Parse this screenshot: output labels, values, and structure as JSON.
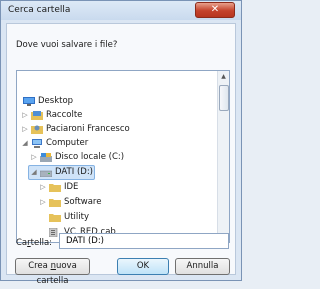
{
  "window": {
    "title": "Cerca cartella",
    "close_glyph": "✕"
  },
  "dialog": {
    "prompt": "Dove vuoi salvare i file?"
  },
  "tree": {
    "items": [
      {
        "label": "Desktop",
        "icon": "desktop-icon"
      },
      {
        "label": "Raccolte",
        "icon": "libraries-icon"
      },
      {
        "label": "Paciaroni Francesco",
        "icon": "user-folder-icon"
      },
      {
        "label": "Computer",
        "icon": "computer-icon"
      },
      {
        "label": "Disco locale (C:)",
        "icon": "local-disk-icon"
      },
      {
        "label": "DATI (D:)",
        "icon": "drive-icon",
        "selected": true
      },
      {
        "label": "IDE",
        "icon": "folder-icon"
      },
      {
        "label": "Software",
        "icon": "folder-icon"
      },
      {
        "label": "Utility",
        "icon": "folder-icon"
      },
      {
        "label": "VC_RED.cab",
        "icon": "cab-file-icon"
      }
    ]
  },
  "folder_field": {
    "label_prefix": "Ca",
    "label_underlined": "r",
    "label_suffix": "tella:",
    "value": "DATI (D:)"
  },
  "buttons": {
    "new_folder_prefix": "Crea ",
    "new_folder_underlined": "n",
    "new_folder_suffix": "uova cartella",
    "ok": "OK",
    "cancel": "Annulla"
  },
  "colors": {
    "folder": "#e6c25a",
    "selection": "#cfe3f8",
    "close_button": "#c4422b"
  }
}
